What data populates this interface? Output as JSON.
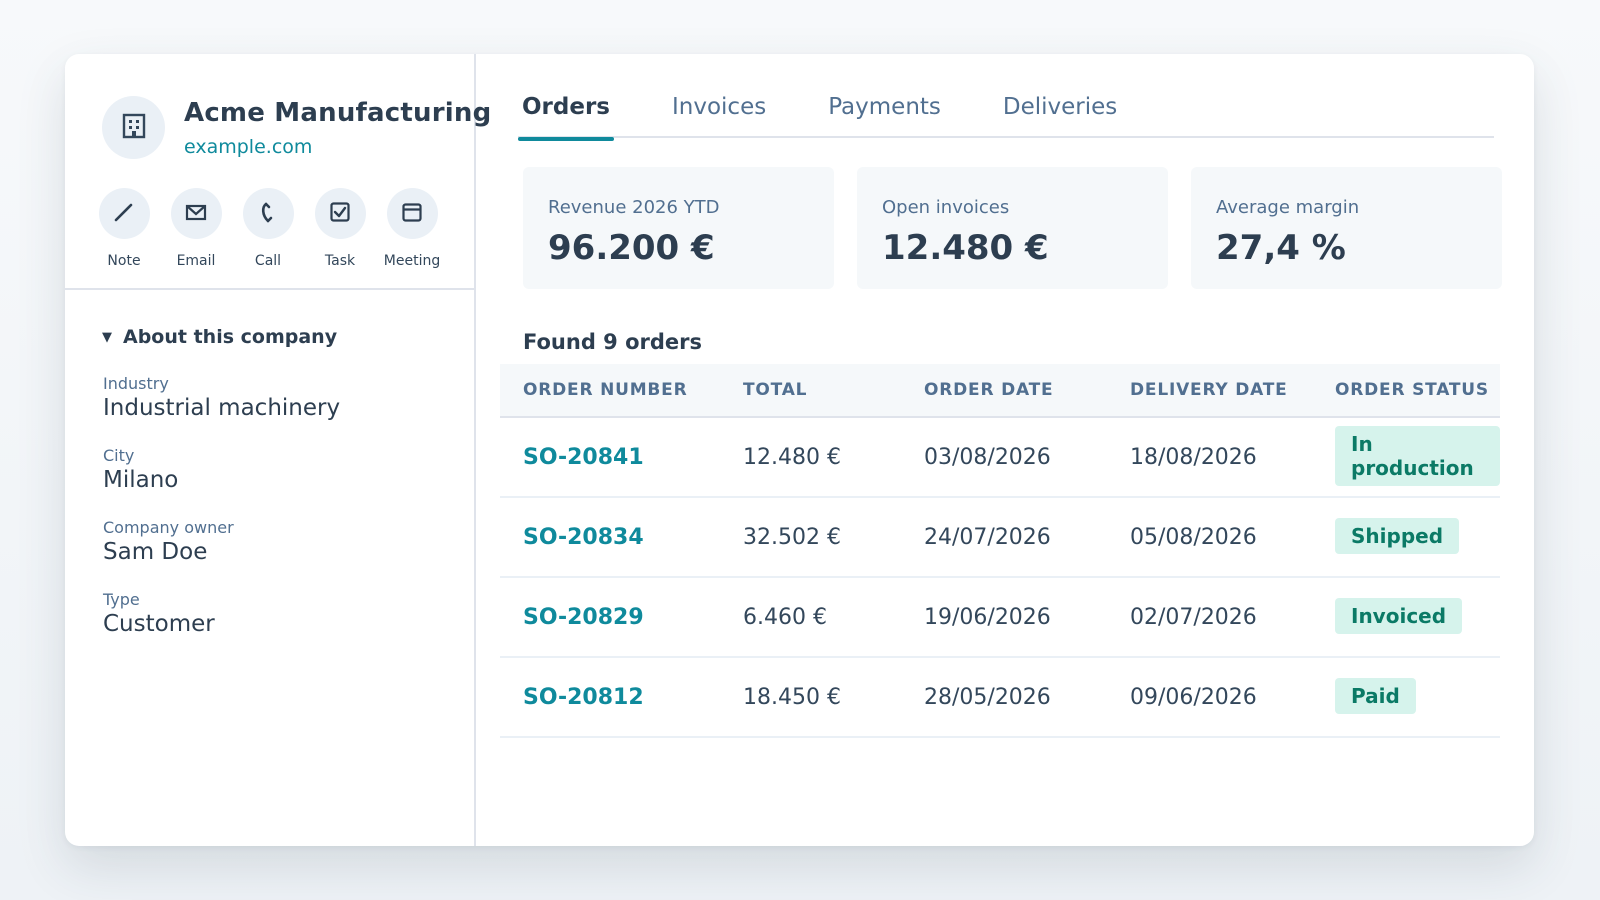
{
  "company": {
    "name": "Acme Manufacturing",
    "domain": "example.com"
  },
  "actions": [
    {
      "label": "Note",
      "icon": "pencil-icon"
    },
    {
      "label": "Email",
      "icon": "envelope-icon"
    },
    {
      "label": "Call",
      "icon": "phone-icon"
    },
    {
      "label": "Task",
      "icon": "task-checkbox-icon"
    },
    {
      "label": "Meeting",
      "icon": "calendar-icon"
    }
  ],
  "about": {
    "title": "About this company",
    "properties": [
      {
        "label": "Industry",
        "value": "Industrial machinery"
      },
      {
        "label": "City",
        "value": "Milano"
      },
      {
        "label": "Company owner",
        "value": "Sam Doe"
      },
      {
        "label": "Type",
        "value": "Customer"
      }
    ]
  },
  "tabs": [
    {
      "label": "Orders",
      "active": true
    },
    {
      "label": "Invoices",
      "active": false
    },
    {
      "label": "Payments",
      "active": false
    },
    {
      "label": "Deliveries",
      "active": false
    }
  ],
  "kpis": [
    {
      "label": "Revenue 2026 YTD",
      "value": "96.200 €"
    },
    {
      "label": "Open invoices",
      "value": "12.480 €"
    },
    {
      "label": "Average margin",
      "value": "27,4 %"
    }
  ],
  "orders": {
    "count_text": "Found 9 orders",
    "columns": [
      "ORDER NUMBER",
      "TOTAL",
      "ORDER DATE",
      "DELIVERY DATE",
      "ORDER STATUS"
    ],
    "rows": [
      {
        "number": "SO-20841",
        "total": "12.480 €",
        "order_date": "03/08/2026",
        "delivery_date": "18/08/2026",
        "status": "In production"
      },
      {
        "number": "SO-20834",
        "total": "32.502 €",
        "order_date": "24/07/2026",
        "delivery_date": "05/08/2026",
        "status": "Shipped"
      },
      {
        "number": "SO-20829",
        "total": "6.460 €",
        "order_date": "19/06/2026",
        "delivery_date": "02/07/2026",
        "status": "Invoiced"
      },
      {
        "number": "SO-20812",
        "total": "18.450 €",
        "order_date": "28/05/2026",
        "delivery_date": "09/06/2026",
        "status": "Paid"
      }
    ]
  },
  "colors": {
    "accent": "#0f8a9c",
    "heading": "#2d3e50",
    "muted": "#516f90",
    "badge_bg": "#d6f3ec",
    "badge_text": "#0b7a66"
  }
}
